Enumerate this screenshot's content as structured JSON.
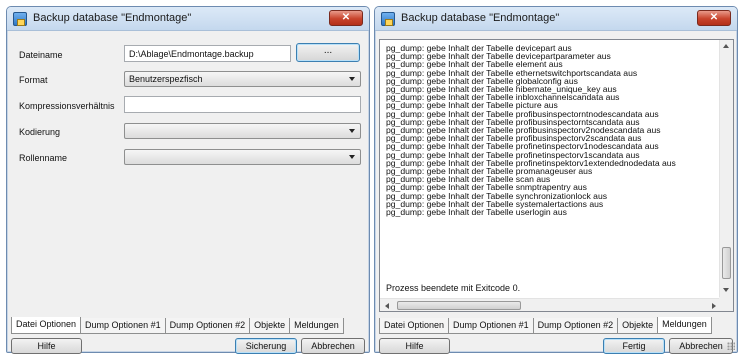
{
  "window_left": {
    "title": "Backup database \"Endmontage\"",
    "close_label": "✕",
    "fields": {
      "dateiname_label": "Dateiname",
      "dateiname_value": "D:\\Ablage\\Endmontage.backup",
      "browse_label": "...",
      "format_label": "Format",
      "format_value": "Benutzerspezfisch",
      "kompression_label": "Kompressionsverhältnis",
      "kompression_value": "",
      "kodierung_label": "Kodierung",
      "kodierung_value": "",
      "rollenname_label": "Rollenname",
      "rollenname_value": ""
    },
    "tabs": [
      "Datei Optionen",
      "Dump Optionen #1",
      "Dump Optionen #2",
      "Objekte",
      "Meldungen"
    ],
    "active_tab": "Datei Optionen",
    "buttons": {
      "help": "Hilfe",
      "backup": "Sicherung",
      "cancel": "Abbrechen"
    }
  },
  "window_right": {
    "title": "Backup database \"Endmontage\"",
    "close_label": "✕",
    "log_lines": [
      "pg_dump: gebe Inhalt der Tabelle devicepart aus",
      "pg_dump: gebe Inhalt der Tabelle devicepartparameter aus",
      "pg_dump: gebe Inhalt der Tabelle element aus",
      "pg_dump: gebe Inhalt der Tabelle ethernetswitchportscandata aus",
      "pg_dump: gebe Inhalt der Tabelle globalconfig aus",
      "pg_dump: gebe Inhalt der Tabelle hibernate_unique_key aus",
      "pg_dump: gebe Inhalt der Tabelle inbloxchannelscandata aus",
      "pg_dump: gebe Inhalt der Tabelle picture aus",
      "pg_dump: gebe Inhalt der Tabelle profibusinspectorntnodescandata aus",
      "pg_dump: gebe Inhalt der Tabelle profibusinspectorntscandata aus",
      "pg_dump: gebe Inhalt der Tabelle profibusinspectorv2nodescandata aus",
      "pg_dump: gebe Inhalt der Tabelle profibusinspectorv2scandata aus",
      "pg_dump: gebe Inhalt der Tabelle profinetinspectorv1nodescandata aus",
      "pg_dump: gebe Inhalt der Tabelle profinetinspectorv1scandata aus",
      "pg_dump: gebe Inhalt der Tabelle profinetinspektorv1extendednodedata aus",
      "pg_dump: gebe Inhalt der Tabelle promanageuser aus",
      "pg_dump: gebe Inhalt der Tabelle scan aus",
      "pg_dump: gebe Inhalt der Tabelle snmptrapentry aus",
      "pg_dump: gebe Inhalt der Tabelle synchronizationlock aus",
      "pg_dump: gebe Inhalt der Tabelle systemalertactions aus",
      "pg_dump: gebe Inhalt der Tabelle userlogin aus"
    ],
    "final_message": "Prozess beendete mit Exitcode 0.",
    "tabs": [
      "Datei Optionen",
      "Dump Optionen #1",
      "Dump Optionen #2",
      "Objekte",
      "Meldungen"
    ],
    "active_tab": "Meldungen",
    "buttons": {
      "help": "Hilfe",
      "done": "Fertig",
      "cancel": "Abbrechen"
    }
  }
}
